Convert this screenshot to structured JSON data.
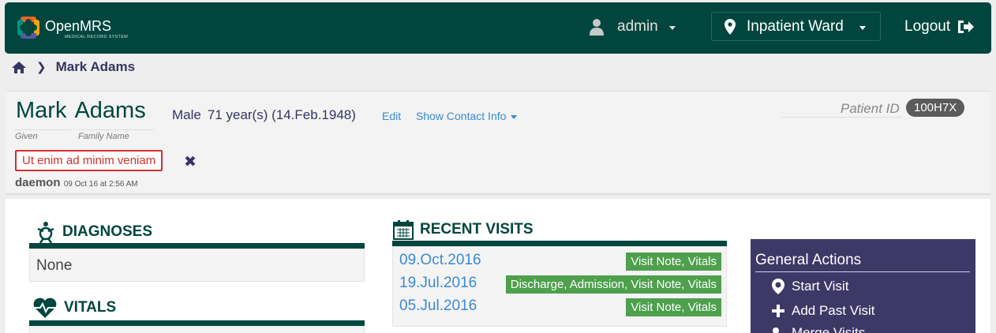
{
  "header": {
    "app_name": "OpenMRS",
    "app_tagline": "MEDICAL RECORD SYSTEM",
    "user": "admin",
    "location": "Inpatient Ward",
    "logout": "Logout"
  },
  "breadcrumb": {
    "home_icon": "home-icon",
    "current": "Mark Adams"
  },
  "patient": {
    "given_name": "Mark",
    "family_name": "Adams",
    "given_label": "Given",
    "family_label": "Family Name",
    "gender": "Male",
    "age": "71 year(s) (14.Feb.1948)",
    "edit": "Edit",
    "show_contact": "Show Contact Info",
    "id_label": "Patient ID",
    "id_value": "100H7X",
    "flag_text": "Ut enim ad minim veniam",
    "flag_close": "✖",
    "flag_author": "daemon",
    "flag_time": "09 Oct 16 at 2:56 AM"
  },
  "sections": {
    "diagnoses_title": "DIAGNOSES",
    "diagnoses_value": "None",
    "vitals_title": "VITALS",
    "recent_visits_title": "RECENT VISITS"
  },
  "recent_visits": [
    {
      "date": "09.Oct.2016",
      "tags": "Visit Note, Vitals"
    },
    {
      "date": "19.Jul.2016",
      "tags": "Discharge, Admission, Visit Note, Vitals"
    },
    {
      "date": "05.Jul.2016",
      "tags": "Visit Note, Vitals"
    }
  ],
  "general_actions": {
    "title": "General Actions",
    "items": [
      "Start Visit",
      "Add Past Visit",
      "Merge Visits"
    ]
  },
  "colors": {
    "header_bg": "#00463f",
    "accent_link": "#3a8ad6",
    "tag_green": "#4ea04c",
    "flag_red": "#d32f2f",
    "actions_bg": "#3e3867"
  }
}
